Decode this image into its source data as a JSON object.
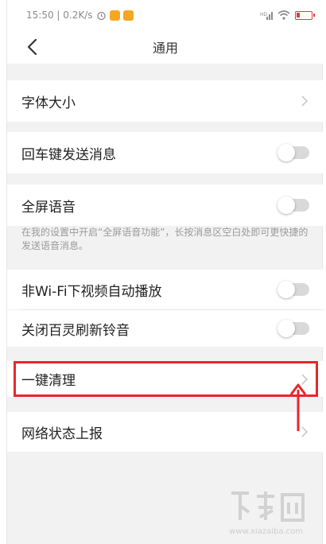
{
  "status_bar": {
    "time_speed": "15:50 | 0.2K/s",
    "battery": "16"
  },
  "header": {
    "title": "通用"
  },
  "rows": {
    "font_size": "字体大小",
    "enter_send": "回车键发送消息",
    "fullscreen_voice": "全屏语音",
    "fullscreen_voice_hint": "在我的设置中开启“全屏语音功能”，长按消息区空白处即可更快捷的发送语音消息。",
    "non_wifi_autoplay": "非Wi-Fi下视频自动播放",
    "close_refresh_ringtone": "关闭百灵刷新铃音",
    "one_click_clean": "一键清理",
    "network_report": "网络状态上报"
  },
  "toggles": {
    "enter_send": false,
    "fullscreen_voice": false,
    "non_wifi_autoplay": false,
    "close_refresh_ringtone": false
  },
  "watermark": {
    "sub": "www.xiazaiba.com"
  },
  "colors": {
    "highlight": "#e8262c",
    "background": "#f2f2f2"
  }
}
